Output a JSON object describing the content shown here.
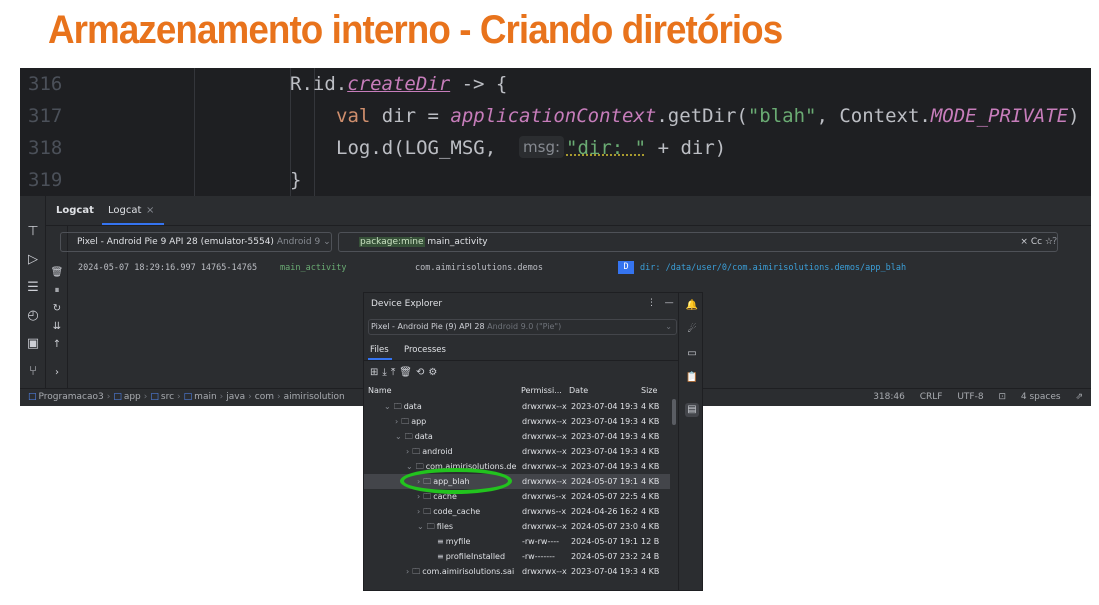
{
  "slide": {
    "title": "Armazenamento interno - Criando diretórios"
  },
  "editor": {
    "lines": [
      {
        "number": "316",
        "indent": 1,
        "tokens": [
          {
            "t": "R.id.",
            "c": "plain"
          },
          {
            "t": "createDir",
            "c": "italic-u"
          },
          {
            "t": " -> {",
            "c": "plain"
          }
        ]
      },
      {
        "number": "317",
        "indent": 2,
        "tokens": [
          {
            "t": "val",
            "c": "kw"
          },
          {
            "t": " dir = ",
            "c": "plain"
          },
          {
            "t": "applicationContext",
            "c": "italic"
          },
          {
            "t": ".getDir(",
            "c": "plain"
          },
          {
            "t": "\"blah\"",
            "c": "str"
          },
          {
            "t": ", Context.",
            "c": "plain"
          },
          {
            "t": "MODE_PRIVATE",
            "c": "italic"
          },
          {
            "t": ")",
            "c": "plain"
          }
        ]
      },
      {
        "number": "318",
        "indent": 2,
        "tokens": [
          {
            "t": "Log.d(LOG_MSG,  ",
            "c": "plain"
          },
          {
            "t": "msg:",
            "c": "hint"
          },
          {
            "t": "\"dir: \"",
            "c": "str-u"
          },
          {
            "t": " + dir)",
            "c": "plain"
          }
        ]
      },
      {
        "number": "319",
        "indent": 1,
        "tokens": [
          {
            "t": "}",
            "c": "plain"
          }
        ]
      }
    ]
  },
  "logcat": {
    "panel_title": "Logcat",
    "tab_label": "Logcat",
    "tab_close": "×",
    "device": {
      "name": "Pixel - Android Pie 9 API 28 (emulator-5554)",
      "os": "Android 9"
    },
    "filter": {
      "key": "package:mine",
      "value": " main_activity",
      "clear": "×",
      "match_case": "Cc",
      "favorite": "☆"
    },
    "log_entry": {
      "timestamp": "2024-05-07 18:29:16.997 14765-14765",
      "tag": "main_activity",
      "package": "com.aimirisolutions.demos",
      "level": "D",
      "message": "dir: /data/user/0/com.aimirisolutions.demos/app_blah"
    }
  },
  "statusbar": {
    "breadcrumbs": [
      "Programacao3",
      "app",
      "src",
      "main",
      "java",
      "com",
      "aimirisolution"
    ],
    "position": "318:46",
    "line_ending": "CRLF",
    "encoding": "UTF-8",
    "indent": "4 spaces"
  },
  "device_explorer": {
    "title": "Device Explorer",
    "device": "Pixel - Android Pie (9) API 28",
    "device_os": "Android 9.0 (\"Pie\")",
    "tabs": [
      "Files",
      "Processes"
    ],
    "columns": {
      "name": "Name",
      "permissions": "Permissi...",
      "date": "Date",
      "size": "Size"
    },
    "rows": [
      {
        "name": "data",
        "depth": 0,
        "expanded": true,
        "perm": "drwxrwx--x",
        "date": "2023-07-04 19:3",
        "size": "4 KB",
        "icon": "folder"
      },
      {
        "name": "app",
        "depth": 1,
        "expanded": false,
        "perm": "drwxrwx--x",
        "date": "2023-07-04 19:3",
        "size": "4 KB",
        "icon": "folder"
      },
      {
        "name": "data",
        "depth": 1,
        "expanded": true,
        "perm": "drwxrwx--x",
        "date": "2023-07-04 19:3",
        "size": "4 KB",
        "icon": "folder"
      },
      {
        "name": "android",
        "depth": 2,
        "expanded": false,
        "perm": "drwxrwx--x",
        "date": "2023-07-04 19:3",
        "size": "4 KB",
        "icon": "folder"
      },
      {
        "name": "com.aimirisolutions.de",
        "depth": 2,
        "expanded": true,
        "perm": "drwxrwx--x",
        "date": "2023-07-04 19:3",
        "size": "4 KB",
        "icon": "folder"
      },
      {
        "name": "app_blah",
        "depth": 3,
        "expanded": false,
        "perm": "drwxrwx--x",
        "date": "2024-05-07 19:1",
        "size": "4 KB",
        "icon": "folder",
        "selected": true
      },
      {
        "name": "cache",
        "depth": 3,
        "expanded": false,
        "perm": "drwxrws--x",
        "date": "2024-05-07 22:5",
        "size": "4 KB",
        "icon": "folder"
      },
      {
        "name": "code_cache",
        "depth": 3,
        "expanded": false,
        "perm": "drwxrws--x",
        "date": "2024-04-26 16:2",
        "size": "4 KB",
        "icon": "folder"
      },
      {
        "name": "files",
        "depth": 3,
        "expanded": true,
        "perm": "drwxrwx--x",
        "date": "2024-05-07 23:0",
        "size": "4 KB",
        "icon": "folder"
      },
      {
        "name": "myfile",
        "depth": 4,
        "expanded": null,
        "perm": "-rw-rw----",
        "date": "2024-05-07 19:1",
        "size": "12 B",
        "icon": "file"
      },
      {
        "name": "profileInstalled",
        "depth": 4,
        "expanded": null,
        "perm": "-rw-------",
        "date": "2024-05-07 23:2",
        "size": "24 B",
        "icon": "file"
      },
      {
        "name": "com.aimirisolutions.sai",
        "depth": 2,
        "expanded": false,
        "perm": "drwxrwx--x",
        "date": "2023-07-04 19:3",
        "size": "4 KB",
        "icon": "folder"
      }
    ]
  },
  "colors": {
    "accent_orange": "#e8731c",
    "highlight_green": "#22c31e",
    "ide_bg": "#1e1f22"
  }
}
